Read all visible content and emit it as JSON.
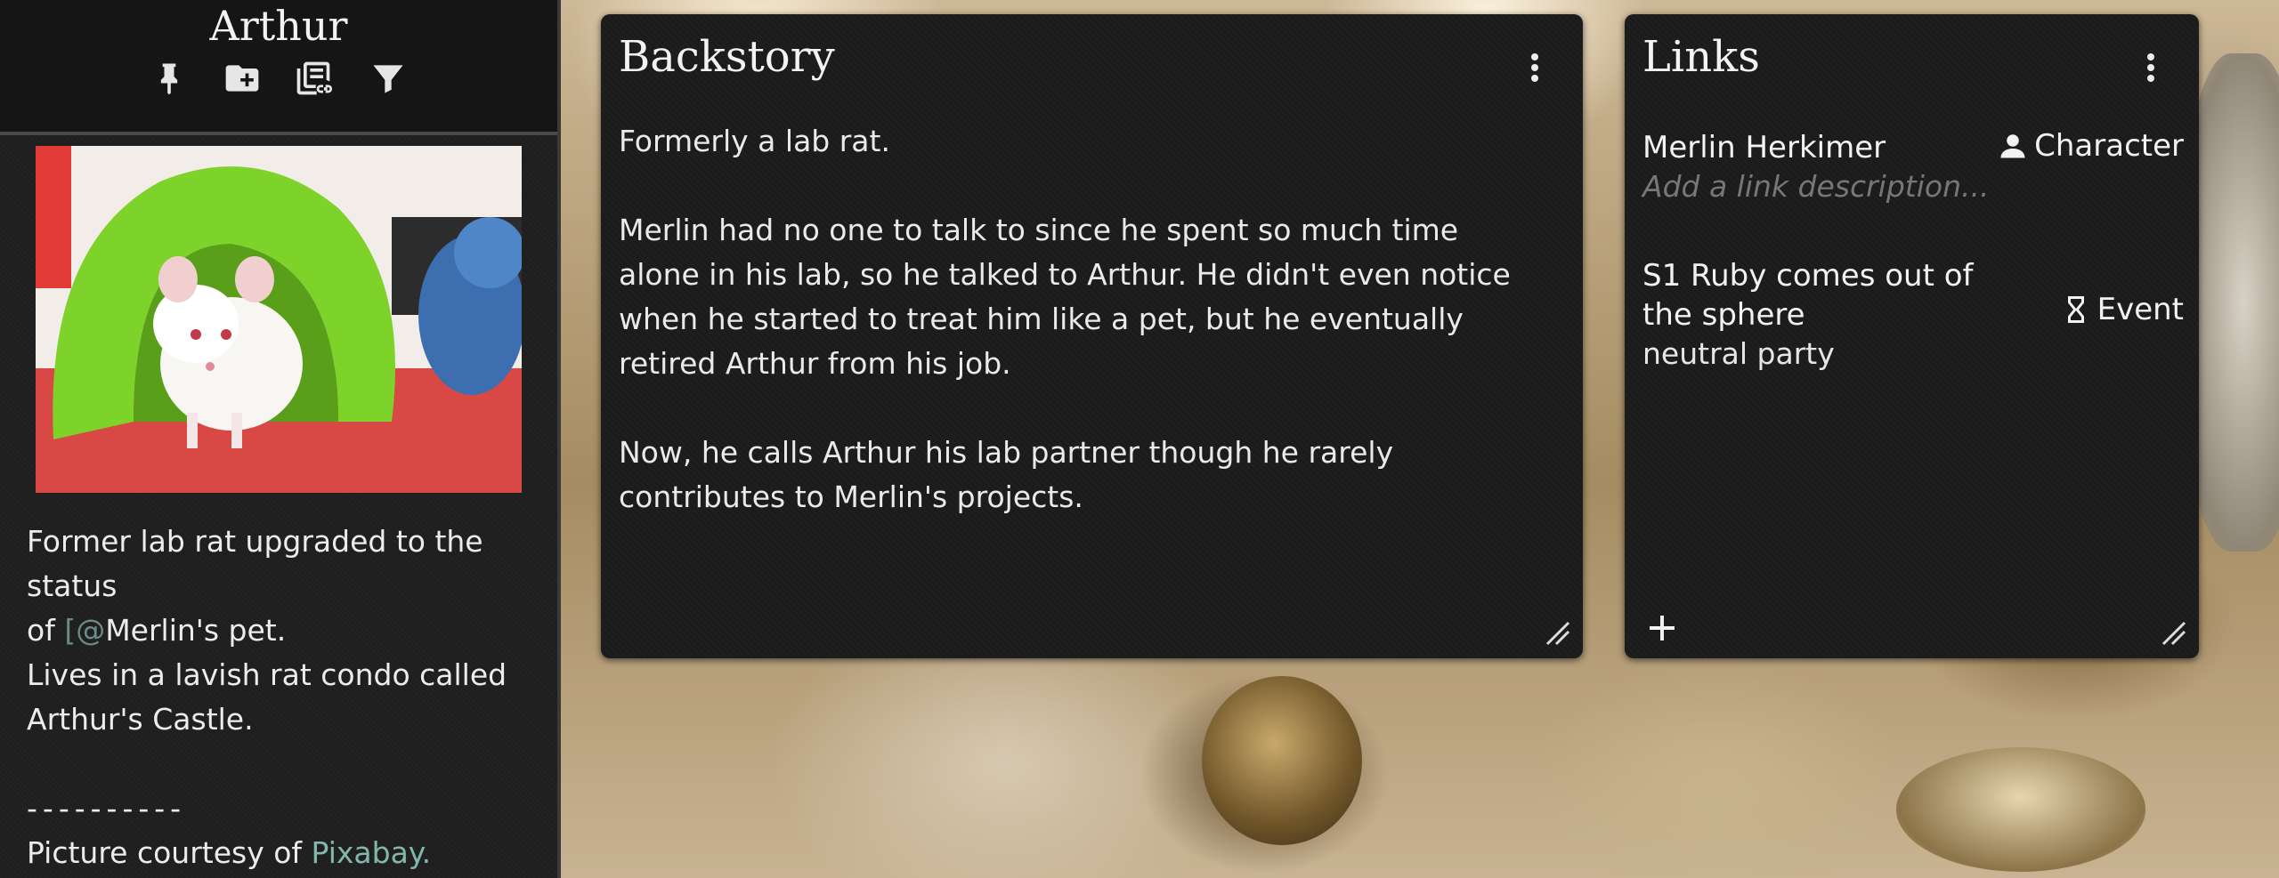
{
  "sidebar": {
    "title": "Arthur",
    "icons": [
      "pin-icon",
      "add-folder-icon",
      "linked-notes-icon",
      "filter-icon"
    ],
    "image_alt": "White lab rat in a green plastic hut",
    "desc_line1_a": "Former lab rat upgraded to the status",
    "desc_line1_b": "of ",
    "mention_bracket": "[",
    "mention_at": "@",
    "mention_name": "Merlin",
    "desc_line1_c": "'s pet.",
    "desc_line2": "Lives in a lavish rat condo called Arthur's Castle.",
    "divider": "----------",
    "credit_prefix": "Picture courtesy of ",
    "credit_link": "Pixabay."
  },
  "backstory": {
    "title": "Backstory",
    "paragraphs": [
      "Formerly a lab rat.",
      "Merlin had no one to talk to since he spent so much time alone in his lab, so he talked to Arthur. He didn't even notice when he started to treat him like a pet, but he eventually retired Arthur from his job.",
      "Now, he calls Arthur his lab partner though he rarely contributes to Merlin's projects."
    ]
  },
  "links": {
    "title": "Links",
    "items": [
      {
        "name": "Merlin Herkimer",
        "type": "Character",
        "type_icon": "person-icon",
        "description": "",
        "placeholder": "Add a link description..."
      },
      {
        "name": "S1 Ruby comes out of the sphere",
        "type": "Event",
        "type_icon": "hourglass-icon",
        "description": "neutral party",
        "placeholder": ""
      }
    ],
    "add_icon": "plus-icon"
  },
  "colors": {
    "sidebar_bg": "#1e1e1e",
    "card_bg": "#1b1b1b",
    "link_accent": "#82b8ac",
    "placeholder": "#777777"
  }
}
